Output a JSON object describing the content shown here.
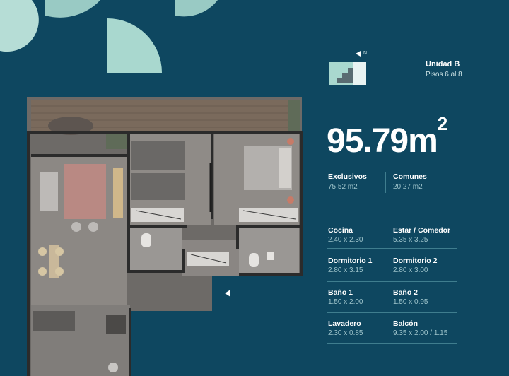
{
  "colors": {
    "background": "#0e4760",
    "accent": "#a9d8cf",
    "muted_text": "#9ec4cb"
  },
  "icons": [
    "compass-north-icon",
    "key-plan-icon",
    "entrance-arrow-icon"
  ],
  "compass_label": "N",
  "unit": {
    "title": "Unidad B",
    "floors": "Pisos 6 al 8"
  },
  "total_area": {
    "value": "95.79m",
    "unit_exponent": "2"
  },
  "areas": [
    {
      "label": "Exclusivos",
      "value": "75.52 m2"
    },
    {
      "label": "Comunes",
      "value": "20.27 m2"
    }
  ],
  "rooms": [
    {
      "name": "Cocina",
      "dims": "2.40 x 2.30"
    },
    {
      "name": "Estar / Comedor",
      "dims": "5.35 x 3.25"
    },
    {
      "name": "Dormitorio 1",
      "dims": "2.80 x 3.15"
    },
    {
      "name": "Dormitorio 2",
      "dims": "2.80 x 3.00"
    },
    {
      "name": "Baño 1",
      "dims": "1.50 x 2.00"
    },
    {
      "name": "Baño 2",
      "dims": "1.50 x 0.95"
    },
    {
      "name": "Lavadero",
      "dims": "2.30 x 0.85"
    },
    {
      "name": "Balcón",
      "dims": "9.35 x 2.00 / 1.15"
    }
  ]
}
